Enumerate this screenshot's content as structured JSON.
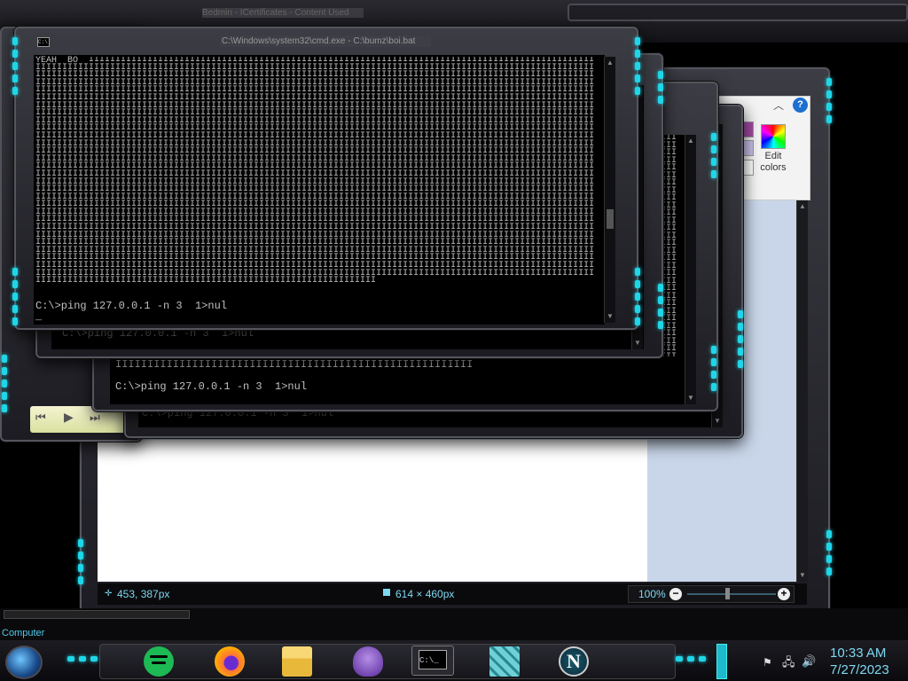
{
  "desktop": {
    "bg_color": "#000000",
    "accent_color": "#1fd6e8"
  },
  "paint": {
    "title": "Bedmin - ICertificates - Content Used",
    "edit_colors_label": "Edit\ncolors",
    "status": {
      "cursor_pos": "453, 387px",
      "canvas_size": "614 × 460px",
      "zoom": "100%"
    },
    "help_icon": "question-icon"
  },
  "cmd_windows": [
    {
      "title": "C:\\Windows\\system32\\cmd.exe - C:\\bumz\\boi.bat",
      "header_line": "YEAH  BO",
      "prompt": "C:\\>ping 127.0.0.1 -n 3  1>nul",
      "cursor": "_"
    },
    {
      "prompt": "C:\\>ping 127.0.0.1 -n 3  1>nul"
    },
    {
      "fill_line": "IIIIIIIIIIIIIIIIIIIIIIIIIIIIIIIIIIIIIIIIIIIIIIIIIIIIIIII",
      "prompt": "C:\\>ping 127.0.0.1 -n 3  1>nul"
    },
    {
      "prompt": "C:\\>ping 127.0.0.1 -n 3  1>nul"
    }
  ],
  "explorer": {
    "status_label": "Computer"
  },
  "taskbar": {
    "apps": [
      {
        "name": "start-orb-icon"
      },
      {
        "name": "spotify-icon"
      },
      {
        "name": "firefox-icon"
      },
      {
        "name": "file-explorer-icon"
      },
      {
        "name": "bonzi-buddy-icon"
      },
      {
        "name": "cmd-icon"
      },
      {
        "name": "blocks-icon"
      },
      {
        "name": "netscape-icon"
      }
    ],
    "netscape_letter": "N",
    "cmd_glyph": "C:\\_",
    "clock": {
      "time": "10:33 AM",
      "date": "7/27/2023"
    }
  }
}
